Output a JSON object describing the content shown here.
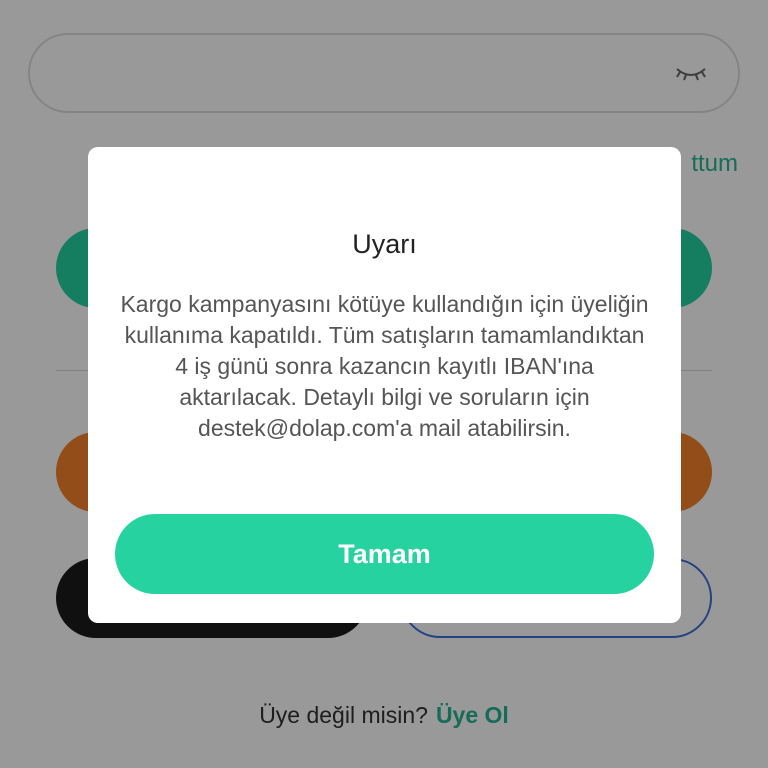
{
  "background": {
    "forgot_link_text": "ttum",
    "signup": {
      "question": "Üye değil misin?",
      "link": "Üye Ol"
    }
  },
  "dialog": {
    "title": "Uyarı",
    "message": "Kargo kampanyasını kötüye kullandığın için üyeliğin kullanıma kapatıldı. Tüm satışların tamamlandıktan 4 iş günü sonra kazancın kayıtlı IBAN'ına aktarılacak. Detaylı bilgi ve soruların için destek@dolap.com'a mail atabilirsin.",
    "ok_label": "Tamam"
  },
  "colors": {
    "accent": "#26d3a0",
    "link": "#26b58f",
    "social_orange": "#f5802b",
    "social_black": "#1c1c1c",
    "social_outline": "#3b6fd8"
  },
  "icons": {
    "password_toggle": "eye-closed-icon"
  }
}
